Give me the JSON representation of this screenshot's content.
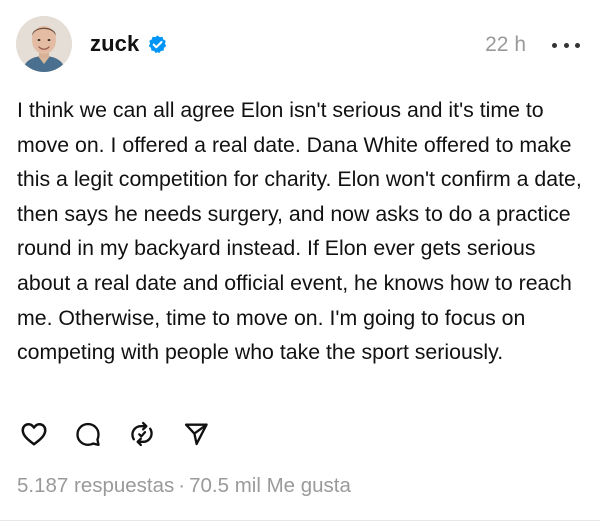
{
  "post": {
    "author": {
      "username": "zuck",
      "verified": true
    },
    "time": "22 h",
    "text": "I think we can all agree Elon isn't serious and it's time to move on. I offered a real date. Dana White offered to make this a legit competition for charity. Elon won't confirm a date, then says he needs surgery, and now asks to do a practice round in my backyard instead. If Elon ever gets serious about a real date and official event, he knows how to reach me. Otherwise, time to move on. I'm going to focus on competing with people who take the sport seriously.",
    "stats": {
      "replies": "5.187 respuestas",
      "separator": "·",
      "likes": "70.5 mil Me gusta"
    },
    "icons": {
      "like": "heart-icon",
      "reply": "comment-icon",
      "repost": "repost-icon",
      "share": "send-icon",
      "more": "more-icon",
      "verified": "verified-badge-icon"
    },
    "colors": {
      "verified": "#0095f6",
      "muted": "#9a9a9a",
      "text": "#111111"
    }
  }
}
